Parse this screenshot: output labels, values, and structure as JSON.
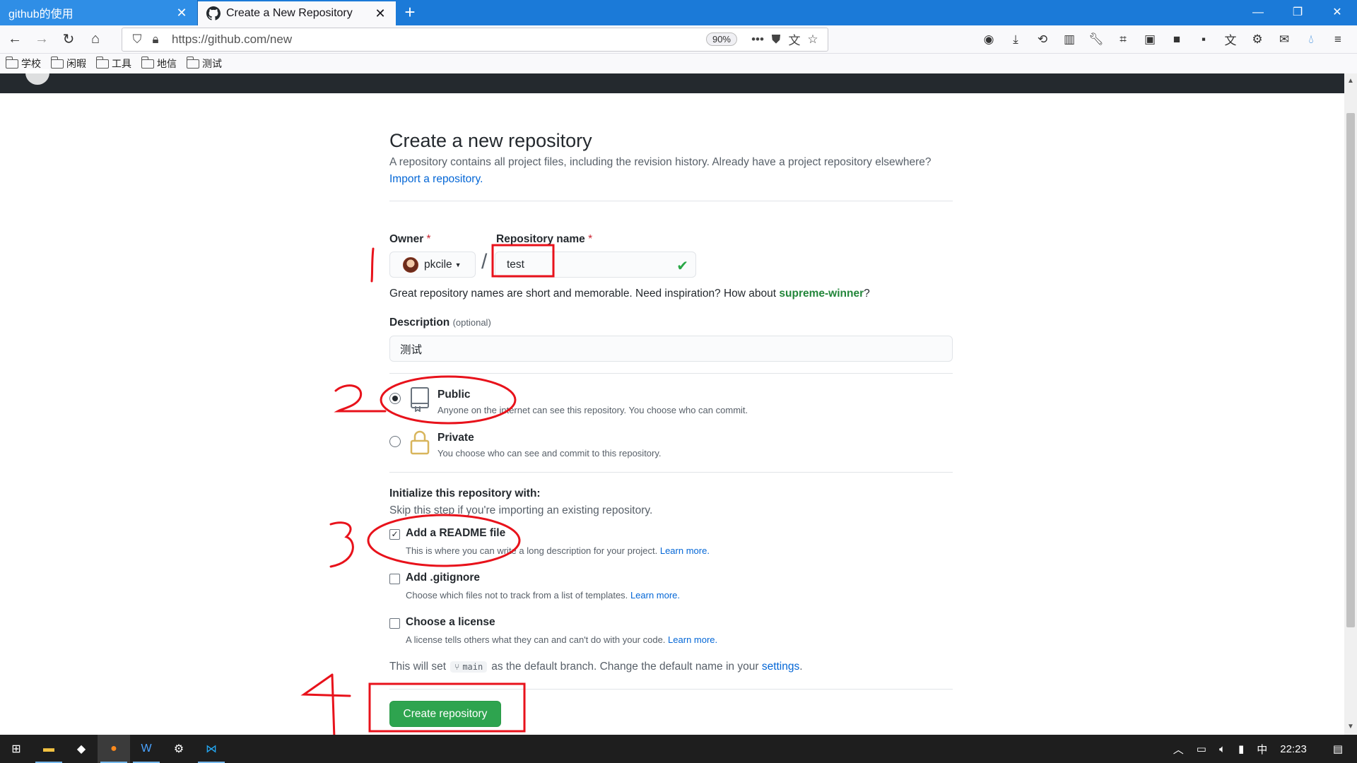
{
  "browser": {
    "tabs": [
      {
        "title": "github的使用",
        "active": false
      },
      {
        "title": "Create a New Repository",
        "active": true
      }
    ],
    "new_tab": "+",
    "window_controls": {
      "minimize": "—",
      "restore": "❐",
      "close": "✕"
    },
    "url": "https://github.com/new",
    "zoom": "90%",
    "bookmarks": [
      "学校",
      "闲暇",
      "工具",
      "地信",
      "测试"
    ]
  },
  "page": {
    "title": "Create a new repository",
    "subtitle": "A repository contains all project files, including the revision history. Already have a project repository elsewhere?",
    "import_link": "Import a repository.",
    "owner_label": "Owner",
    "required_mark": "*",
    "owner_value": "pkcile",
    "slash": "/",
    "repo_name_label": "Repository name",
    "repo_name_value": "test",
    "name_hint_prefix": "Great repository names are short and memorable. Need inspiration? How about",
    "name_suggestion": "supreme-winner",
    "name_hint_suffix": "?",
    "description_label": "Description",
    "description_optional": "(optional)",
    "description_value": "测试",
    "visibility": {
      "selected": "public",
      "public_title": "Public",
      "public_desc": "Anyone on the internet can see this repository. You choose who can commit.",
      "private_title": "Private",
      "private_desc": "You choose who can see and commit to this repository."
    },
    "init_title": "Initialize this repository with:",
    "init_sub": "Skip this step if you're importing an existing repository.",
    "init_options": [
      {
        "title": "Add a README file",
        "desc": "This is where you can write a long description for your project.",
        "link": "Learn more.",
        "checked": true
      },
      {
        "title": "Add .gitignore",
        "desc": "Choose which files not to track from a list of templates.",
        "link": "Learn more.",
        "checked": false
      },
      {
        "title": "Choose a license",
        "desc": "A license tells others what they can and can't do with your code.",
        "link": "Learn more.",
        "checked": false
      }
    ],
    "branch_prefix": "This will set",
    "branch_name": "main",
    "branch_suffix": "as the default branch. Change the default name in your",
    "settings_link": "settings",
    "period": ".",
    "create_button": "Create repository"
  },
  "taskbar": {
    "clock": "22:23",
    "ime": "中"
  },
  "colors": {
    "browser_accent": "#1b7ad8",
    "primary_green": "#2ea44f",
    "link_blue": "#0366d6",
    "annotation_red": "#e8121b"
  }
}
